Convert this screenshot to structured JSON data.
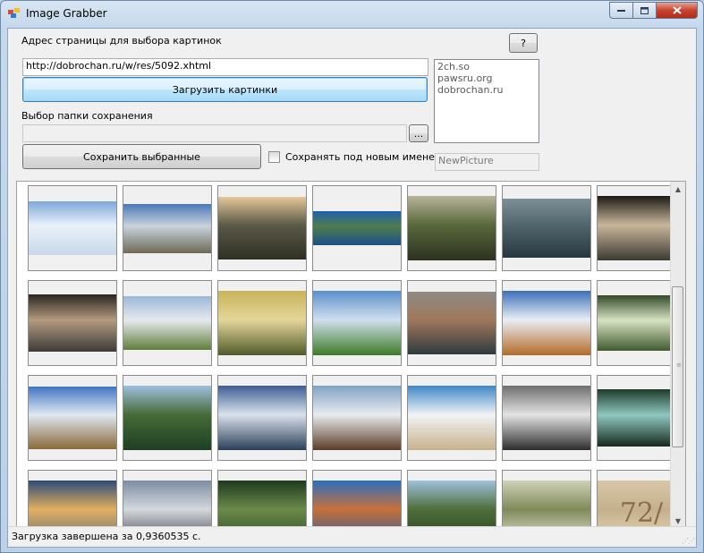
{
  "window": {
    "title": "Image Grabber",
    "minimize_icon": "minimize-icon",
    "maximize_icon": "maximize-icon",
    "close_icon": "close-icon"
  },
  "form": {
    "url_label": "Адрес страницы для выбора картинок",
    "help_button": "?",
    "url_value": "http://dobrochan.ru/w/res/5092.xhtml",
    "load_button": "Загрузить картинки",
    "folder_label": "Выбор папки сохранения",
    "folder_value": "",
    "browse_button": "...",
    "save_button": "Сохранить выбранные",
    "rename_checkbox_label": "Сохранять под новым именем",
    "rename_checked": false,
    "new_name_placeholder": "NewPicture"
  },
  "sites": [
    "2ch.so",
    "pawsru.org",
    "dobrochan.ru"
  ],
  "gallery": {
    "rows": [
      [
        "winter-lake",
        "snowy-mountains",
        "sunset-valley",
        "mountain-lake",
        "dark-meadow",
        "misty-horizon",
        "cave-lake"
      ],
      [
        "dark-sunset",
        "green-plains",
        "golden-sky",
        "green-hills",
        "river-canyon",
        "autumn-alps",
        "forest-light"
      ],
      [
        "matterhorn",
        "alpine-valley",
        "blue-storm",
        "waterfall-rainbow",
        "sea-of-clouds",
        "bw-river",
        "forest-waterfall"
      ],
      [
        "dusk-horizon",
        "mountain-peak",
        "green-forest",
        "red-rocks",
        "pine-forest",
        "mossy-ruins",
        "stone-number"
      ]
    ],
    "stone_text": "72/"
  },
  "status": {
    "text": "Загрузка завершена за 0,9360535 с."
  },
  "colors": {
    "accent": "#3c7fb1",
    "close": "#c7442f"
  }
}
